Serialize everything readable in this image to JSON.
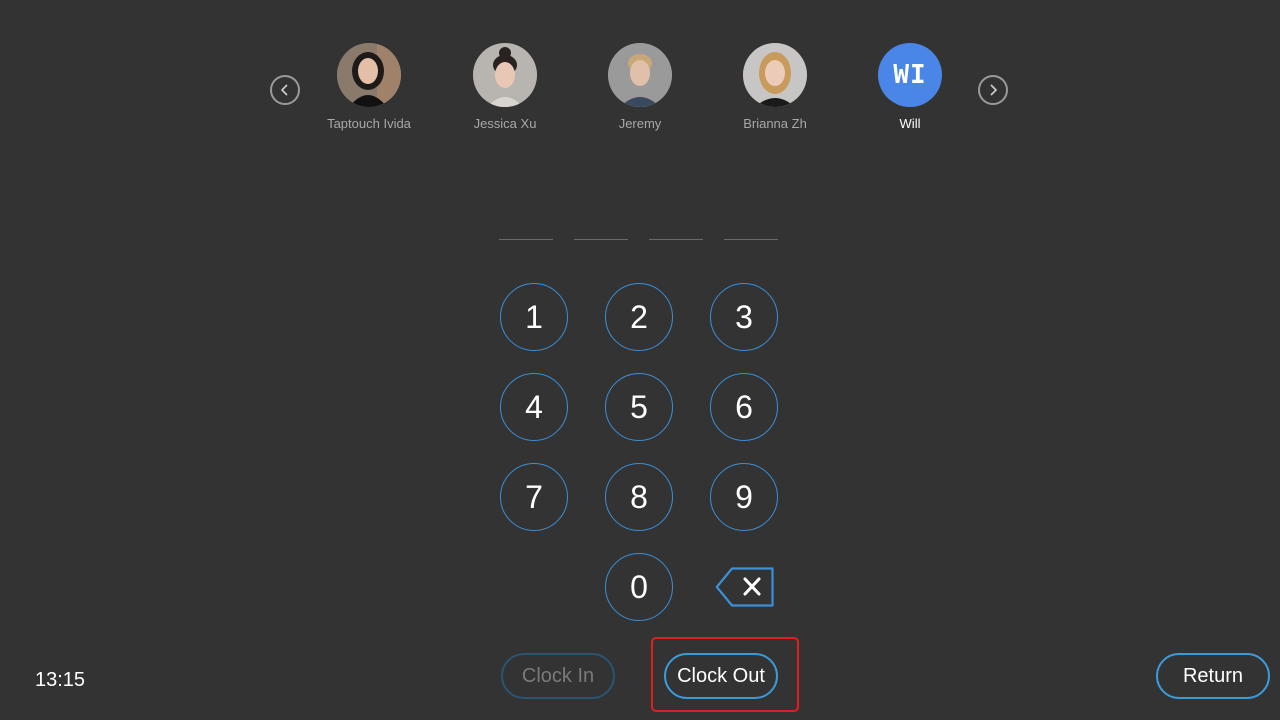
{
  "carousel": {
    "prev_icon": "chevron-left-icon",
    "next_icon": "chevron-right-icon",
    "users": [
      {
        "name": "Taptouch Ivida",
        "avatar": "photo",
        "selected": false
      },
      {
        "name": "Jessica Xu",
        "avatar": "photo",
        "selected": false
      },
      {
        "name": "Jeremy",
        "avatar": "photo",
        "selected": false
      },
      {
        "name": "Brianna Zh",
        "avatar": "photo",
        "selected": false
      },
      {
        "name": "Will",
        "avatar": "initials",
        "initials": "WI",
        "selected": true
      }
    ]
  },
  "pin": {
    "slot_count": 4,
    "entered": ""
  },
  "keypad": {
    "keys": [
      "1",
      "2",
      "3",
      "4",
      "5",
      "6",
      "7",
      "8",
      "9",
      "0"
    ],
    "backspace_icon": "backspace-icon"
  },
  "footer": {
    "time": "13:15",
    "clock_in_label": "Clock In",
    "clock_out_label": "Clock Out",
    "return_label": "Return"
  },
  "colors": {
    "background": "#333333",
    "accent": "#3b9ad8",
    "avatar_initials_bg": "#4a86e8",
    "highlight": "#e02020",
    "muted_text": "#a8a8a8"
  }
}
